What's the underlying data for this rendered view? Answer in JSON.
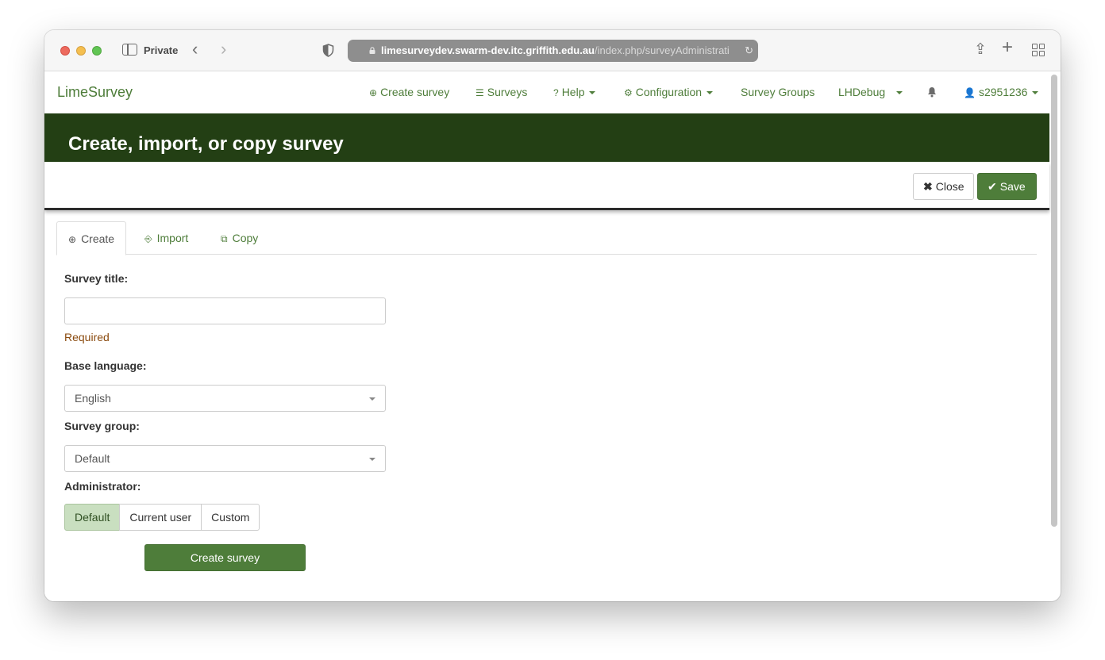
{
  "browser": {
    "private_label": "Private",
    "url_host": "limesurveydev.swarm-dev.itc.griffith.edu.au",
    "url_path": "/index.php/surveyAdministrati"
  },
  "nav": {
    "brand": "LimeSurvey",
    "create_survey": "Create survey",
    "surveys": "Surveys",
    "help": "Help",
    "configuration": "Configuration",
    "survey_groups": "Survey Groups",
    "debug": "LHDebug",
    "user": "s2951236"
  },
  "header": {
    "title": "Create, import, or copy survey"
  },
  "actions": {
    "close_label": "Close",
    "save_label": "Save"
  },
  "tabs": [
    {
      "label": "Create",
      "active": true
    },
    {
      "label": "Import",
      "active": false
    },
    {
      "label": "Copy",
      "active": false
    }
  ],
  "form": {
    "title_label": "Survey title:",
    "title_value": "",
    "required_text": "Required",
    "language_label": "Base language:",
    "language_value": "English",
    "group_label": "Survey group:",
    "group_value": "Default",
    "admin_label": "Administrator:",
    "admin_options": [
      "Default",
      "Current user",
      "Custom"
    ],
    "admin_selected": "Default",
    "submit_label": "Create survey"
  },
  "colors": {
    "brand_green": "#4e7d3a",
    "banner_bg": "#233f14",
    "required_text": "#8a4a0e"
  }
}
